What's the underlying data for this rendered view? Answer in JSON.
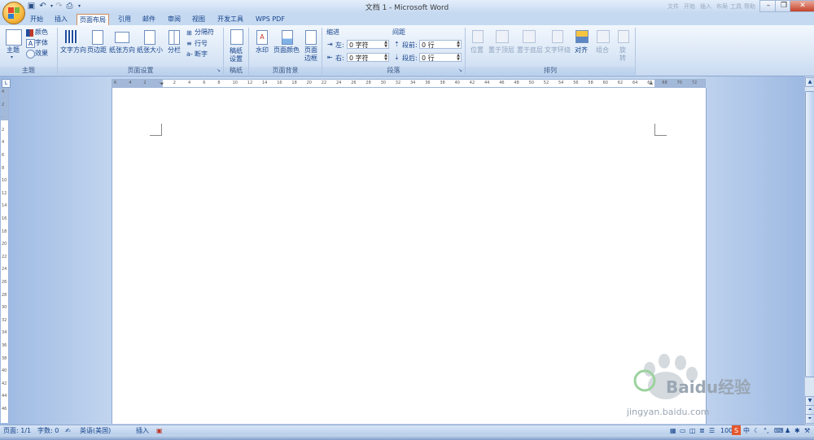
{
  "window": {
    "title": "文档 1 - Microsoft Word",
    "faint_right": [
      "文件",
      "开始",
      "插入",
      "布局",
      "工具",
      "帮助"
    ]
  },
  "tabs": [
    "开始",
    "插入",
    "页面布局",
    "引用",
    "邮件",
    "审阅",
    "视图",
    "开发工具",
    "WPS PDF"
  ],
  "active_tab": "页面布局",
  "ribbon": {
    "theme_group": {
      "title": "主题",
      "theme_label": "主题",
      "colors_label": "颜色",
      "fonts_label": "字体",
      "effects_label": "效果"
    },
    "page_setup": {
      "title": "页面设置",
      "text_direction": "文字方向",
      "margins": "页边距",
      "orientation": "纸张方向",
      "size": "纸张大小",
      "columns": "分栏",
      "breaks": "分隔符",
      "line_numbers": "行号",
      "hyphenation": "断字"
    },
    "draft": {
      "title": "稿纸",
      "settings": "稿纸\n设置"
    },
    "page_background": {
      "title": "页面背景",
      "watermark": "水印",
      "page_color": "页面颜色",
      "page_borders": "页面\n边框"
    },
    "paragraph": {
      "title": "段落",
      "indent_title": "缩进",
      "left_label": "左:",
      "left_value": "0 字符",
      "right_label": "右:",
      "right_value": "0 字符",
      "spacing_title": "间距",
      "before_label": "段前:",
      "before_value": "0 行",
      "after_label": "段后:",
      "after_value": "0 行"
    },
    "arrange": {
      "title": "排列",
      "position": "位置",
      "bring_front": "置于顶层",
      "send_back": "置于底层",
      "text_wrap": "文字环绕",
      "align": "对齐",
      "group": "组合",
      "rotate": "旋\n转"
    }
  },
  "ruler": {
    "horizontal_ticks": [
      "6",
      "4",
      "2",
      "",
      "2",
      "4",
      "6",
      "8",
      "10",
      "12",
      "14",
      "16",
      "18",
      "20",
      "22",
      "24",
      "26",
      "28",
      "30",
      "32",
      "34",
      "36",
      "38",
      "40",
      "42",
      "44",
      "46",
      "48",
      "50",
      "52",
      "54",
      "56",
      "58",
      "60",
      "62",
      "64",
      "66",
      "68",
      "70",
      "72"
    ],
    "vertical_ticks": [
      "4",
      "2",
      "",
      "2",
      "4",
      "6",
      "8",
      "10",
      "12",
      "14",
      "16",
      "18",
      "20",
      "22",
      "24",
      "26",
      "28",
      "30",
      "32",
      "34",
      "36",
      "38",
      "40",
      "42",
      "44",
      "46"
    ]
  },
  "statusbar": {
    "page": "页面: 1/1",
    "words": "字数: 0",
    "language": "英语(美国)",
    "mode": "插入",
    "zoom": "100",
    "ime": "中"
  },
  "watermark": {
    "brand": "Baidu经验",
    "url": "jingyan.baidu.com"
  }
}
